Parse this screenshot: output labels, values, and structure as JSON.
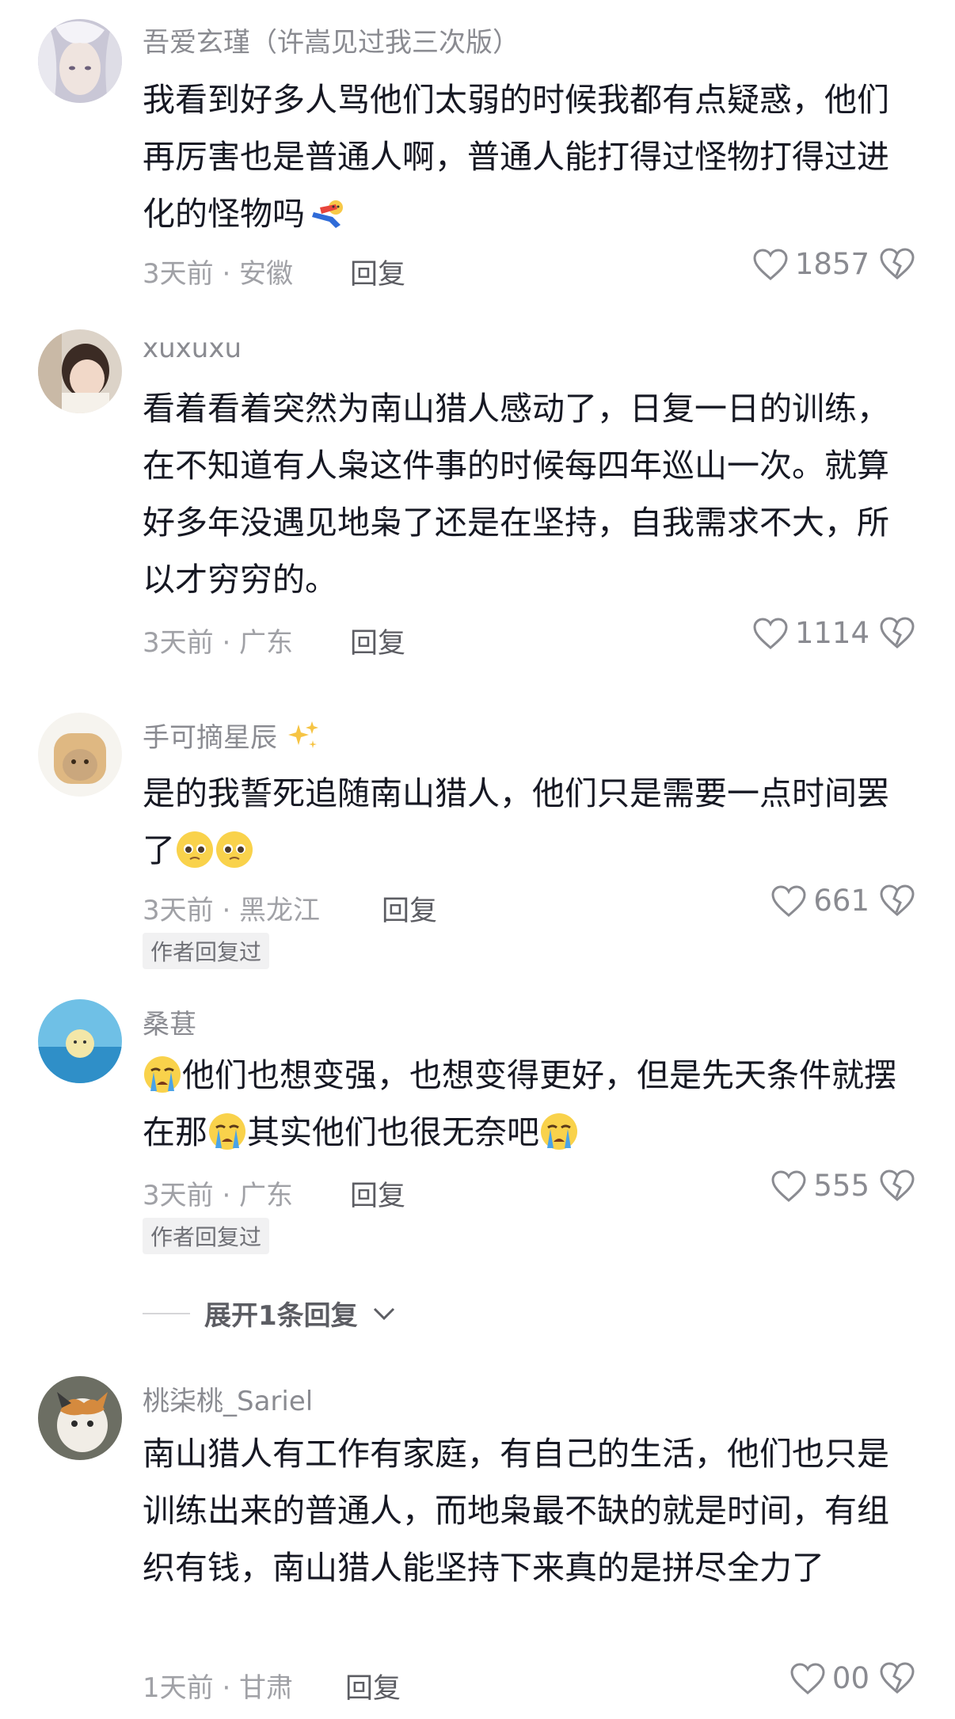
{
  "comments": [
    {
      "username": "吾爱玄瑾（许嵩见过我三次版）",
      "text": "我看到好多人骂他们太弱的时候我都有点疑惑，他们再厉害也是普通人啊，普通人能打得过怪物打得过进化的怪物吗",
      "meta": "3天前 · 安徽",
      "reply": "回复",
      "likes": "1857"
    },
    {
      "username": "xuxuxu",
      "text": "看着看着突然为南山猎人感动了，日复一日的训练，在不知道有人枭这件事的时候每四年巡山一次。就算好多年没遇见地枭了还是在坚持，自我需求不大，所以才穷穷的。",
      "meta": "3天前 · 广东",
      "reply": "回复",
      "likes": "1114"
    },
    {
      "username": "手可摘星辰",
      "text": "是的我誓死追随南山猎人，他们只是需要一点时间罢了",
      "meta": "3天前 · 黑龙江",
      "reply": "回复",
      "likes": "661",
      "badge": "作者回复过"
    },
    {
      "username": "桑葚",
      "text_a": "他们也想变强，也想变得更好，但是先天条件就摆在那",
      "text_b": "其实他们也很无奈吧",
      "meta": "3天前 · 广东",
      "reply": "回复",
      "likes": "555",
      "badge": "作者回复过"
    },
    {
      "username": "桃柒桃_Sariel",
      "text": "南山猎人有工作有家庭，有自己的生活，他们也只是训练出来的普通人，而地枭最不缺的就是时间，有组织有钱，南山猎人能坚持下来真的是拼尽全力了",
      "meta": "1天前 · 甘肃",
      "reply": "回复",
      "likes": "00"
    }
  ],
  "expand_replies": "展开1条回复",
  "icons": {
    "like": "heart-outline-icon",
    "dislike": "broken-heart-icon",
    "expand": "chevron-down-icon"
  },
  "colors": {
    "text": "#161823",
    "muted": "#8a8b91",
    "meta": "#a0a1a6"
  }
}
